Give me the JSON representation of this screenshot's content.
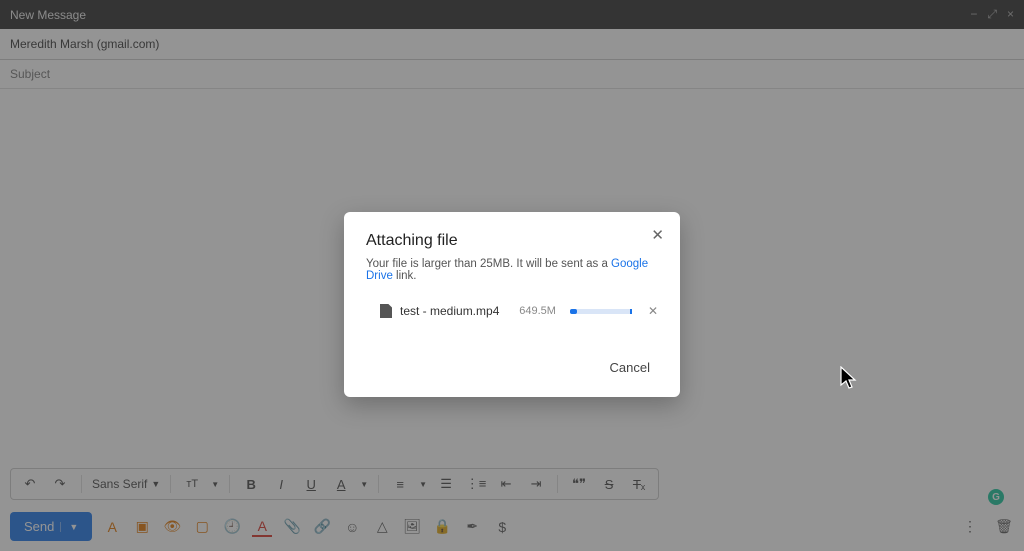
{
  "window": {
    "title": "New Message",
    "recipient": "Meredith Marsh (gmail.com)",
    "subject_placeholder": "Subject"
  },
  "toolbar": {
    "font_family": "Sans Serif",
    "send_label": "Send"
  },
  "modal": {
    "title": "Attaching file",
    "message_prefix": "Your file is larger than 25MB. It will be sent as a ",
    "drive_link_text": "Google Drive",
    "message_suffix": " link.",
    "file_name": "test - medium.mp4",
    "file_size": "649.5M",
    "cancel_label": "Cancel"
  },
  "icons": {
    "minimize": "−",
    "expand": "⤢",
    "close": "×"
  }
}
